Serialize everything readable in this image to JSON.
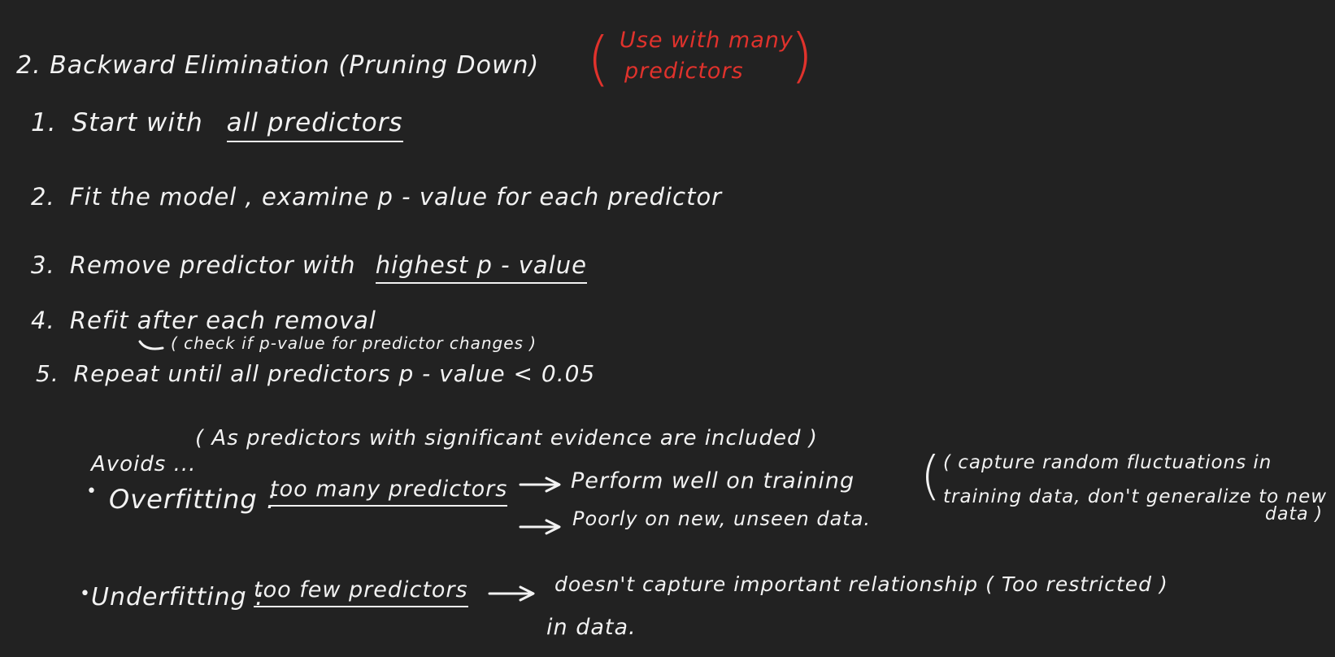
{
  "title": "2.  Backward  Elimination  (Pruning  Down)",
  "note_red": {
    "line1": "Use  with  many",
    "line2": "predictors"
  },
  "steps": [
    {
      "num": "1.",
      "text_before": "Start  with",
      "underlined": "all  predictors",
      "text_after": ""
    },
    {
      "num": "2.",
      "text_before": "Fit  the  model ,  examine   p - value  for  each  predictor",
      "underlined": "",
      "text_after": ""
    },
    {
      "num": "3.",
      "text_before": "Remove  predictor  with",
      "underlined": "highest  p - value",
      "text_after": ""
    },
    {
      "num": "4.",
      "text_before": "Refit  after  each  removal",
      "underlined": "",
      "text_after": ""
    },
    {
      "num": "5.",
      "text_before": "Repeat  until  all  predictors   p - value  < 0.05",
      "underlined": "",
      "text_after": ""
    }
  ],
  "step4_note": "( check  if  p-value  for  predictor  changes )",
  "avoids_label": "Avoids ...",
  "avoids_note": "( As  predictors  with  significant  evidence  are  included )",
  "overfitting": {
    "bullet": "•",
    "label": "Overfitting :",
    "cause": "too  many  predictors",
    "effect1": "Perform  well  on  training",
    "effect2": "Poorly  on  new,  unseen  data.",
    "aside_line1": "( capture  random  fluctuations  in",
    "aside_line2": "training  data,  don't  generalize  to  new",
    "aside_line3": "data )"
  },
  "underfitting": {
    "bullet": "•",
    "label": "Underfitting :",
    "cause": "too  few  predictors",
    "effect_line1": "doesn't  capture  important  relationship   ( Too  restricted )",
    "effect_line2": "in  data."
  },
  "colors": {
    "background": "#222222",
    "ink": "#f2f2f2",
    "accent": "#e0322c"
  }
}
